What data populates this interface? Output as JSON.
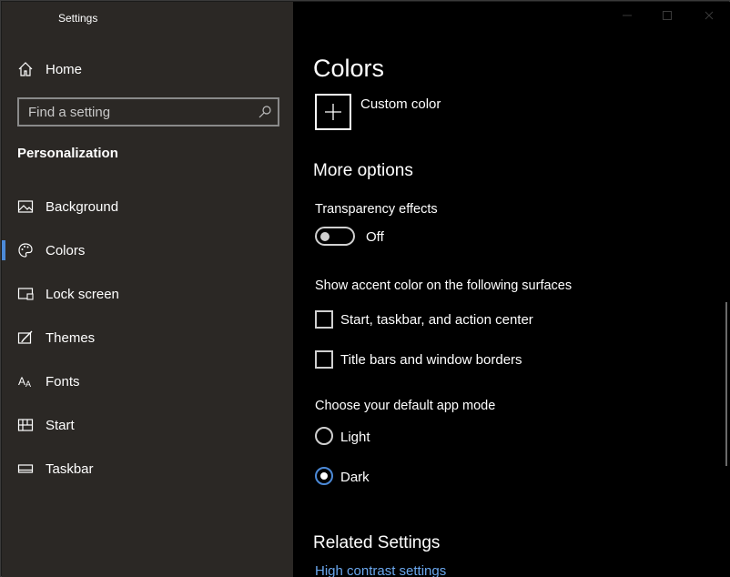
{
  "app": {
    "title": "Settings"
  },
  "sidebar": {
    "home_label": "Home",
    "search_placeholder": "Find a setting",
    "section_title": "Personalization",
    "items": [
      {
        "label": "Background",
        "icon": "picture-icon"
      },
      {
        "label": "Colors",
        "icon": "palette-icon",
        "active": true
      },
      {
        "label": "Lock screen",
        "icon": "lock-screen-icon"
      },
      {
        "label": "Themes",
        "icon": "brush-icon"
      },
      {
        "label": "Fonts",
        "icon": "fonts-icon"
      },
      {
        "label": "Start",
        "icon": "start-icon"
      },
      {
        "label": "Taskbar",
        "icon": "taskbar-icon"
      }
    ]
  },
  "main": {
    "title": "Colors",
    "custom_color_label": "Custom color",
    "more_options_title": "More options",
    "transparency": {
      "label": "Transparency effects",
      "state": "Off",
      "on": false
    },
    "accent_surfaces": {
      "label": "Show accent color on the following surfaces",
      "options": [
        {
          "label": "Start, taskbar, and action center",
          "checked": false
        },
        {
          "label": "Title bars and window borders",
          "checked": false
        }
      ]
    },
    "app_mode": {
      "label": "Choose your default app mode",
      "options": [
        {
          "label": "Light",
          "selected": false
        },
        {
          "label": "Dark",
          "selected": true
        }
      ]
    },
    "related_title": "Related Settings",
    "related_link": "High contrast settings"
  },
  "colors": {
    "accent": "#4c8ad8",
    "sidebar_bg": "#2b2825",
    "main_bg": "#000000",
    "link": "#6aa7ee"
  }
}
